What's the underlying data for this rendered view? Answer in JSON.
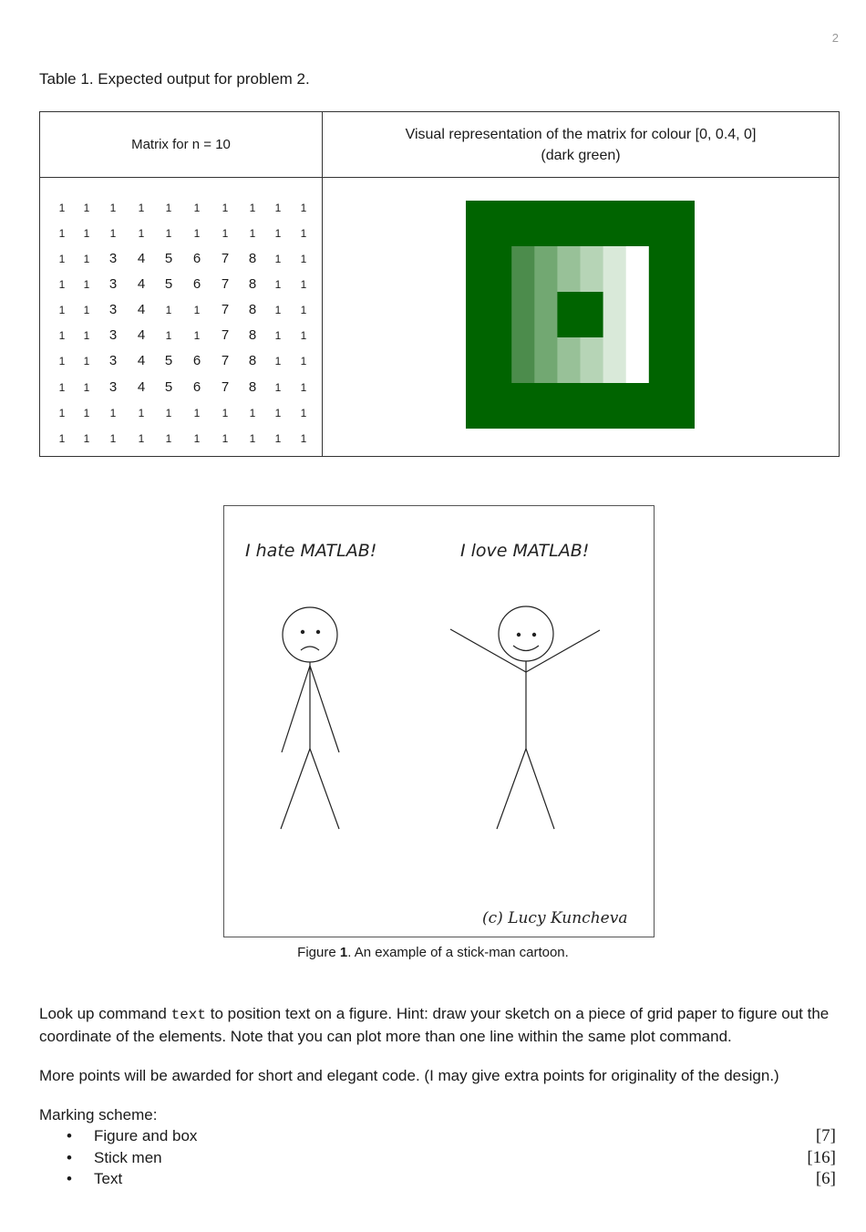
{
  "page_number": "2",
  "table_caption": "Table 1. Expected output for problem 2.",
  "table": {
    "col1_header": "Matrix for n = 10",
    "col2_header_line1": "Visual representation of the matrix for colour [0, 0.4, 0]",
    "col2_header_line2": "(dark green)",
    "matrix": [
      [
        "1",
        "1",
        "1",
        "1",
        "1",
        "1",
        "1",
        "1",
        "1",
        "1"
      ],
      [
        "1",
        "1",
        "1",
        "1",
        "1",
        "1",
        "1",
        "1",
        "1",
        "1"
      ],
      [
        "1",
        "1",
        "3",
        "4",
        "5",
        "6",
        "7",
        "8",
        "1",
        "1"
      ],
      [
        "1",
        "1",
        "3",
        "4",
        "5",
        "6",
        "7",
        "8",
        "1",
        "1"
      ],
      [
        "1",
        "1",
        "3",
        "4",
        "1",
        "1",
        "7",
        "8",
        "1",
        "1"
      ],
      [
        "1",
        "1",
        "3",
        "4",
        "1",
        "1",
        "7",
        "8",
        "1",
        "1"
      ],
      [
        "1",
        "1",
        "3",
        "4",
        "5",
        "6",
        "7",
        "8",
        "1",
        "1"
      ],
      [
        "1",
        "1",
        "3",
        "4",
        "5",
        "6",
        "7",
        "8",
        "1",
        "1"
      ],
      [
        "1",
        "1",
        "1",
        "1",
        "1",
        "1",
        "1",
        "1",
        "1",
        "1"
      ],
      [
        "1",
        "1",
        "1",
        "1",
        "1",
        "1",
        "1",
        "1",
        "1",
        "1"
      ]
    ],
    "colors": {
      "dark_green": "#006400",
      "shade_3": "#4c8c4c",
      "shade_4": "#72a872",
      "shade_5": "#98c198",
      "shade_6": "#b6d4b6",
      "shade_7": "#d9e9d9",
      "shade_8": "#ffffff"
    }
  },
  "cartoon": {
    "left_speech": "I hate MATLAB!",
    "right_speech": "I love MATLAB!",
    "credit": "(c) Lucy Kuncheva"
  },
  "figure_caption": {
    "prefix": "Figure ",
    "number": "1",
    "text": ". An example of a stick-man cartoon."
  },
  "paragraph_1": {
    "before": "Look up command ",
    "command": "text",
    "after": " to position text on a figure. Hint: draw your sketch on a piece of grid paper to figure out the coordinate of the elements. Note that you can plot more than one line within the same plot command."
  },
  "paragraph_2": "More points will be awarded for short and elegant code. (I may give extra points for originality of the design.)",
  "marking_scheme": {
    "title": "Marking scheme:",
    "bullet": "•",
    "items": [
      {
        "label": "Figure and box",
        "points": "[7]"
      },
      {
        "label": "Stick men",
        "points": "[16]"
      },
      {
        "label": "Text",
        "points": "[6]"
      }
    ]
  }
}
